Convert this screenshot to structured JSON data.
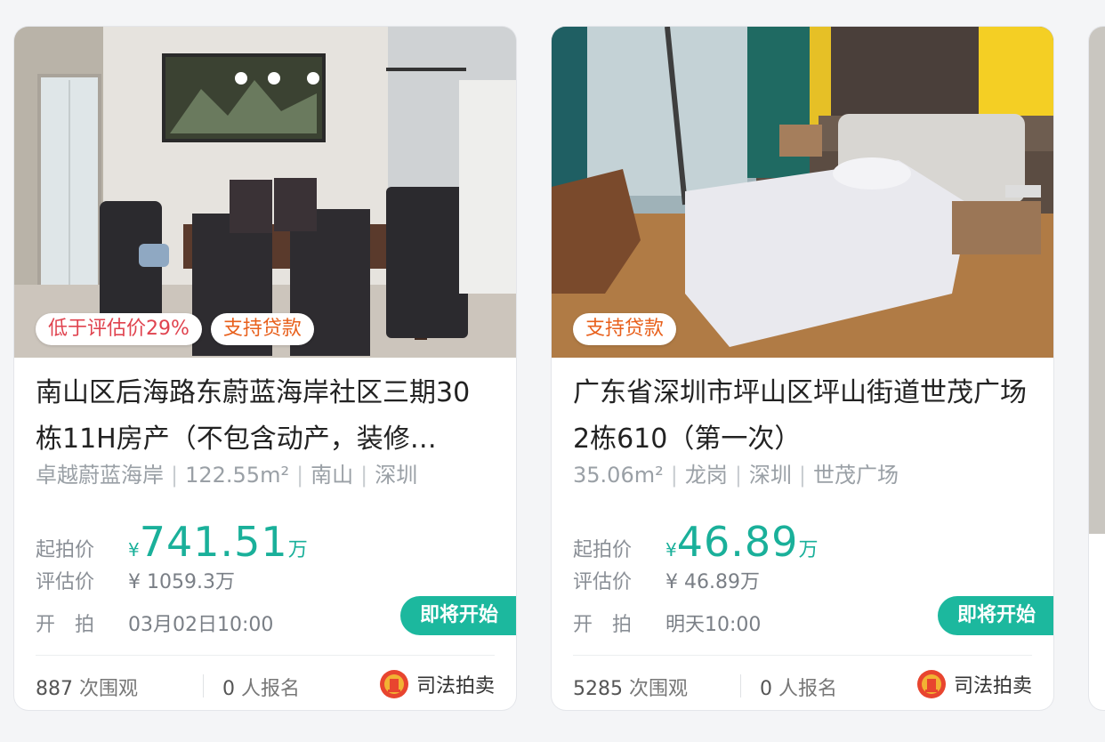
{
  "listings": [
    {
      "tags": [
        "低于评估价29%",
        "支持贷款"
      ],
      "title": "南山区后海路东蔚蓝海岸社区三期30栋11H房产（不包含动产，装修…",
      "meta": [
        "卓越蔚蓝海岸",
        "122.55m²",
        "南山",
        "深圳"
      ],
      "start_price_label": "起拍价",
      "start_price_symbol": "¥",
      "start_price_value": "741.51",
      "start_price_unit": "万",
      "eval_label": "评估价",
      "eval_value": "¥ 1059.3万",
      "time_label": "开　拍",
      "time_value": "03月02日10:00",
      "status": "即将开始",
      "views_count": "887",
      "views_label": "次围观",
      "signups_count": "0",
      "signups_label": "人报名",
      "source": "司法拍卖"
    },
    {
      "tags": [
        "支持贷款"
      ],
      "title": "广东省深圳市坪山区坪山街道世茂广场2栋610（第一次）",
      "meta": [
        "35.06m²",
        "龙岗",
        "深圳",
        "世茂广场"
      ],
      "start_price_label": "起拍价",
      "start_price_symbol": "¥",
      "start_price_value": "46.89",
      "start_price_unit": "万",
      "eval_label": "评估价",
      "eval_value": "¥ 46.89万",
      "time_label": "开　拍",
      "time_value": "明天10:00",
      "status": "即将开始",
      "views_count": "5285",
      "views_label": "次围观",
      "signups_count": "0",
      "signups_label": "人报名",
      "source": "司法拍卖"
    }
  ],
  "colors": {
    "accent": "#1ab09a",
    "status_bg": "#1cb89e",
    "tag_red": "#e0434f",
    "tag_orange": "#e8601c"
  },
  "icons": {
    "court": "court-emblem-icon"
  }
}
